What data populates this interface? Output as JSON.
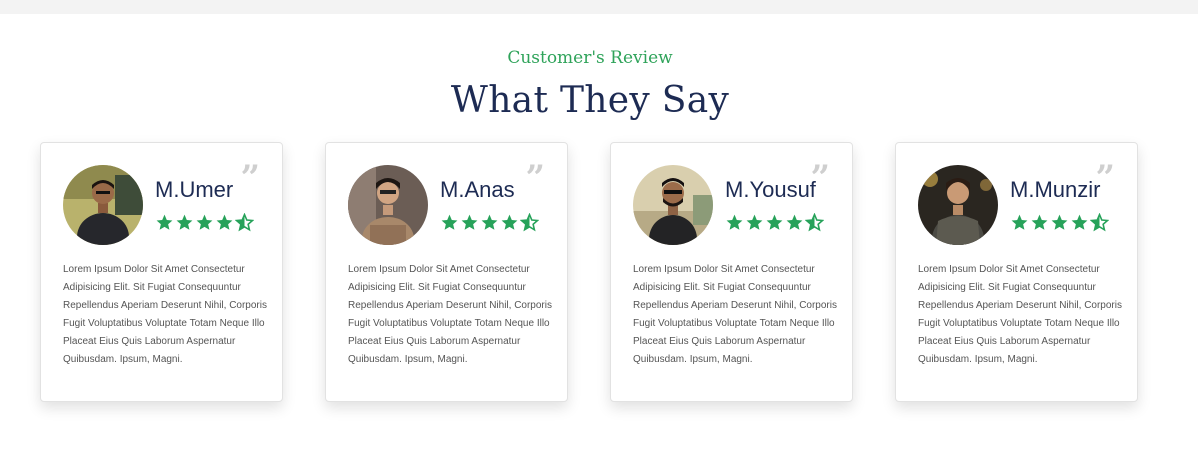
{
  "section": {
    "subtitle": "Customer's Review",
    "title": "What They Say"
  },
  "colors": {
    "accent": "#2fa35a",
    "heading": "#1d2b53",
    "star": "#27a25a"
  },
  "reviews": [
    {
      "name": "M.Umer",
      "rating": 4.5,
      "text": "Lorem Ipsum Dolor Sit Amet Consectetur Adipisicing Elit. Sit Fugiat Consequuntur Repellendus Aperiam Deserunt Nihil, Corporis Fugit Voluptatibus Voluptate Totam Neque Illo Placeat Eius Quis Laborum Aspernatur Quibusdam. Ipsum, Magni."
    },
    {
      "name": "M.Anas",
      "rating": 4.5,
      "text": "Lorem Ipsum Dolor Sit Amet Consectetur Adipisicing Elit. Sit Fugiat Consequuntur Repellendus Aperiam Deserunt Nihil, Corporis Fugit Voluptatibus Voluptate Totam Neque Illo Placeat Eius Quis Laborum Aspernatur Quibusdam. Ipsum, Magni."
    },
    {
      "name": "M.Yousuf",
      "rating": 4.5,
      "text": "Lorem Ipsum Dolor Sit Amet Consectetur Adipisicing Elit. Sit Fugiat Consequuntur Repellendus Aperiam Deserunt Nihil, Corporis Fugit Voluptatibus Voluptate Totam Neque Illo Placeat Eius Quis Laborum Aspernatur Quibusdam. Ipsum, Magni."
    },
    {
      "name": "M.Munzir",
      "rating": 4.5,
      "text": "Lorem Ipsum Dolor Sit Amet Consectetur Adipisicing Elit. Sit Fugiat Consequuntur Repellendus Aperiam Deserunt Nihil, Corporis Fugit Voluptatibus Voluptate Totam Neque Illo Placeat Eius Quis Laborum Aspernatur Quibusdam. Ipsum, Magni."
    }
  ],
  "icons": {
    "quote": "quote-icon",
    "star": "star-icon",
    "half_star": "star-half-icon"
  }
}
